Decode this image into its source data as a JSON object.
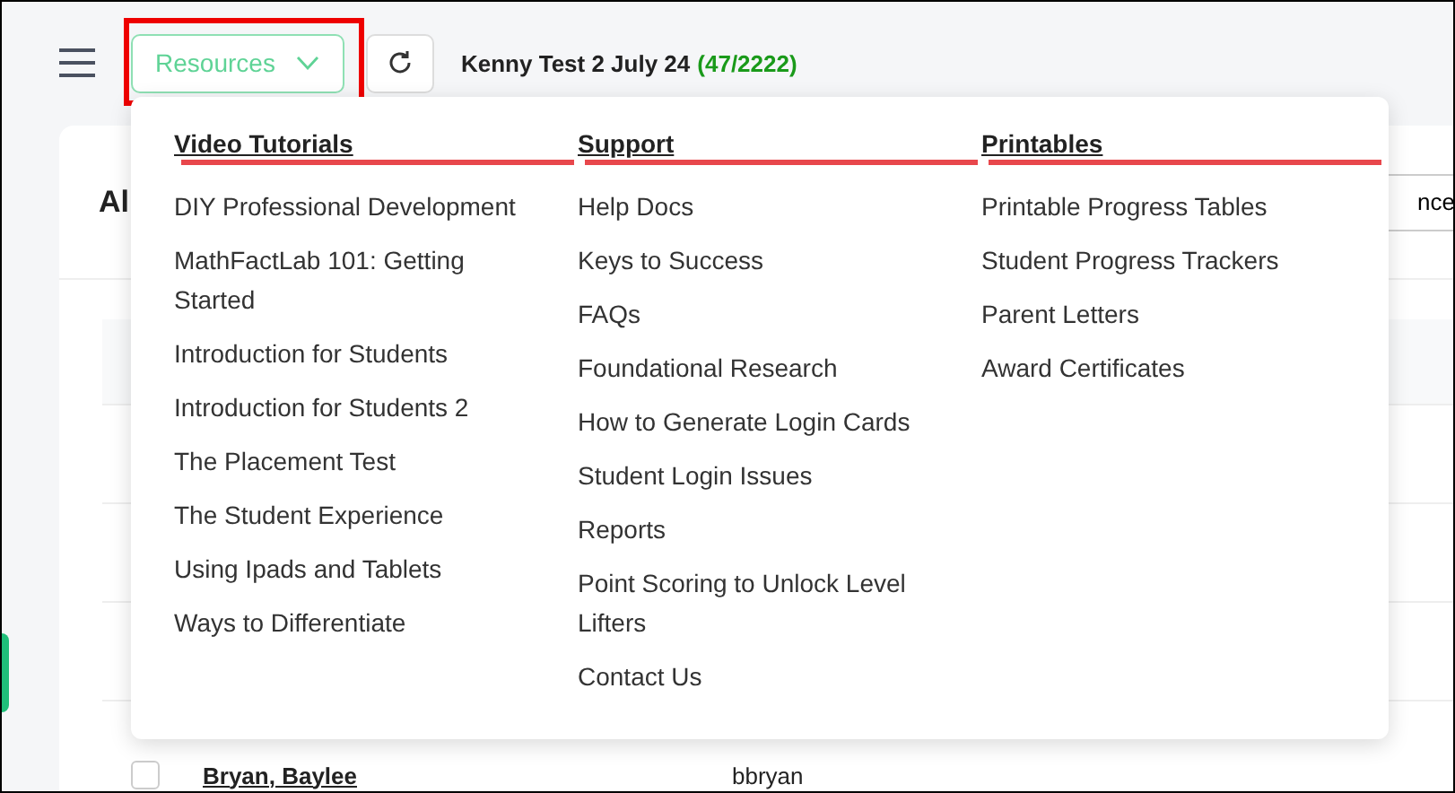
{
  "toolbar": {
    "resources_button": {
      "label": "Resources",
      "highlighted": true
    },
    "class_title": "Kenny Test 2 July 24",
    "count": "(47/2222)"
  },
  "page": {
    "heading": "Al",
    "action_button": "nce",
    "rows": [
      {
        "name": "Bryan, Baylee",
        "username": "bbryan",
        "checked": false
      }
    ]
  },
  "menu": {
    "columns": [
      {
        "heading": "Video Tutorials",
        "underlined": true,
        "items": [
          "DIY Professional Development",
          "MathFactLab 101: Getting Started",
          "Introduction for Students",
          "Introduction for Students 2",
          "The Placement Test",
          "The Student Experience",
          "Using Ipads and Tablets",
          "Ways to Differentiate"
        ]
      },
      {
        "heading": "Support",
        "underlined": true,
        "items": [
          "Help Docs",
          "Keys to Success",
          "FAQs",
          "Foundational Research",
          "How to Generate Login Cards",
          "Student Login Issues",
          "Reports",
          "Point Scoring to Unlock Level Lifters",
          "Contact Us"
        ]
      },
      {
        "heading": "Printables",
        "underlined": true,
        "items": [
          "Printable Progress Tables",
          "Student Progress Trackers",
          "Parent Letters",
          "Award Certificates"
        ]
      }
    ]
  }
}
